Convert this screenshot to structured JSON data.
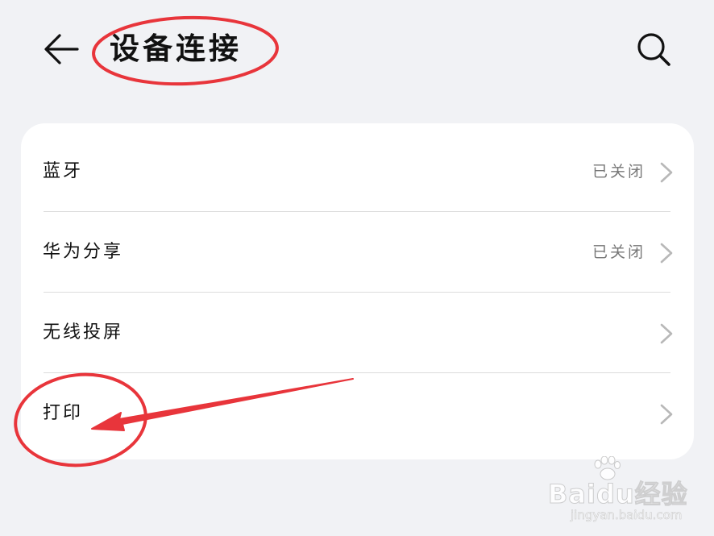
{
  "header": {
    "title": "设备连接",
    "back_icon": "arrow-left-icon",
    "search_icon": "search-icon"
  },
  "settings": {
    "items": [
      {
        "label": "蓝牙",
        "value": "已关闭"
      },
      {
        "label": "华为分享",
        "value": "已关闭"
      },
      {
        "label": "无线投屏",
        "value": ""
      },
      {
        "label": "打印",
        "value": ""
      }
    ]
  },
  "annotations": {
    "color": "#e8353b"
  },
  "watermark": {
    "brand": "Baidu经验",
    "url": "jingyan.baidu.com"
  }
}
